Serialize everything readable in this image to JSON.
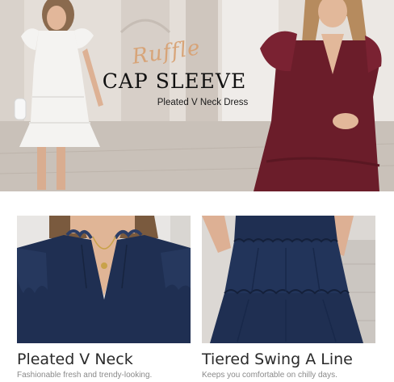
{
  "hero": {
    "script_text": "Ruffle",
    "title": "CAP SLEEVE",
    "subtitle": "Pleated V Neck Dress"
  },
  "features": [
    {
      "title": "Pleated V Neck",
      "description": "Fashionable fresh and trendy-looking."
    },
    {
      "title": "Tiered Swing A Line",
      "description": "Keeps you comfortable on chilly days."
    }
  ],
  "colors": {
    "navy_dress": "#1f2f52",
    "burgundy_dress": "#6b1d2a",
    "white_dress": "#f4f3f1",
    "script_accent": "#d8a274"
  }
}
